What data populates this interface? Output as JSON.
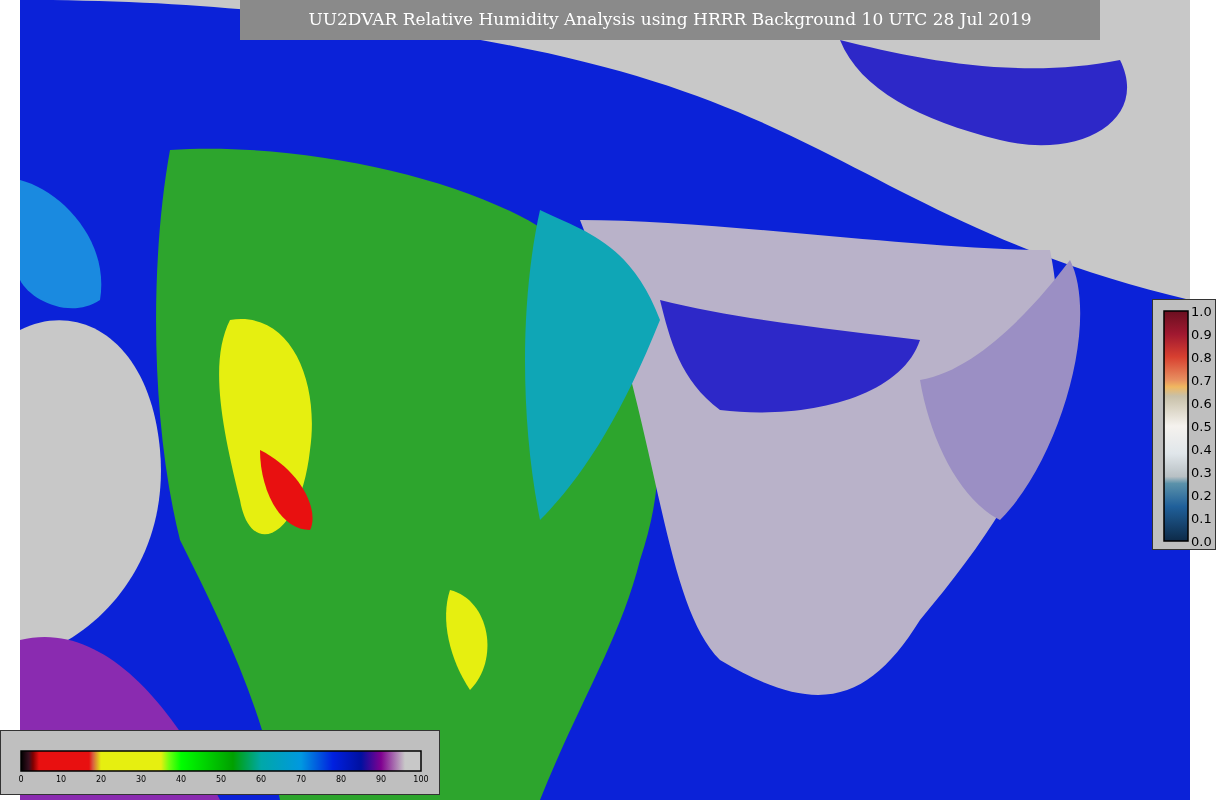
{
  "title": "UU2DVAR Relative Humidity Analysis using HRRR Background 10 UTC 28 Jul 2019",
  "humidity_colorbar": {
    "ticks": [
      "0",
      "10",
      "20",
      "30",
      "40",
      "50",
      "60",
      "70",
      "80",
      "90",
      "100"
    ]
  },
  "station_colorbar": {
    "ticks": [
      "1.0",
      "0.9",
      "0.8",
      "0.7",
      "0.6",
      "0.5",
      "0.4",
      "0.3",
      "0.2",
      "0.1",
      "0.0"
    ]
  }
}
